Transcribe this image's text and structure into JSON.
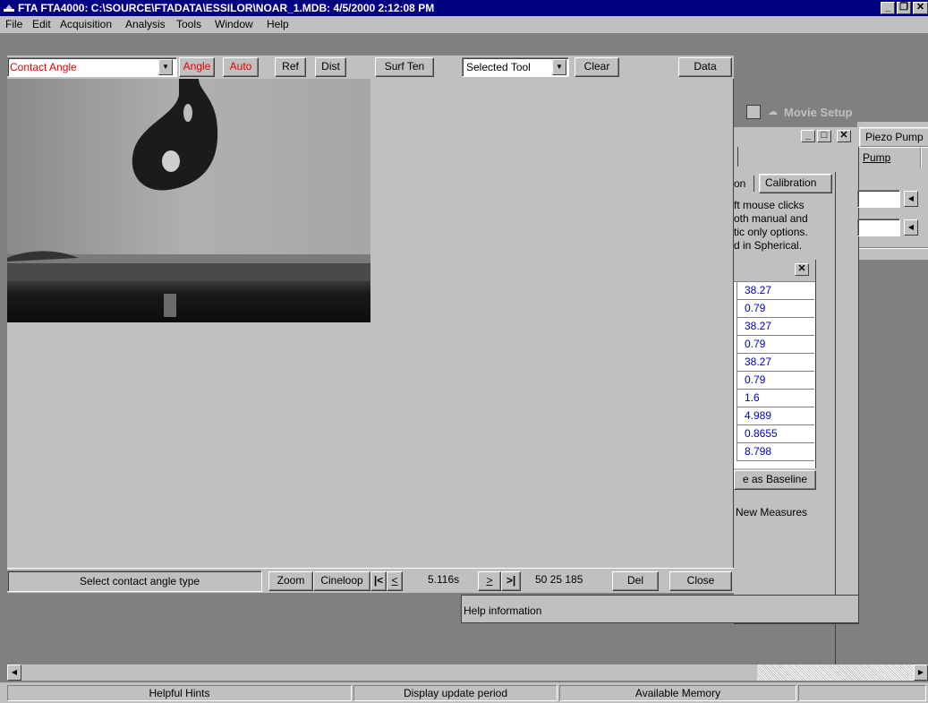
{
  "window": {
    "title": "FTA FTA4000: C:\\SOURCE\\FTADATA\\ESSILOR\\NOAR_1.MDB: 4/5/2000 2:12:08 PM",
    "minimize": "_",
    "restore": "❐",
    "close": "✕"
  },
  "menu": {
    "file": "File",
    "edit": "Edit",
    "acquisition": "Acquisition",
    "analysis": "Analysis",
    "tools": "Tools",
    "window": "Window",
    "help": "Help"
  },
  "toolbar": {
    "measurement_type": "Contact Angle",
    "angle": "Angle",
    "auto": "Auto",
    "ref": "Ref",
    "dist": "Dist",
    "surf_ten": "Surf Ten",
    "tool_select": "Selected Tool",
    "clear": "Clear",
    "data": "Data"
  },
  "movie_setup": {
    "title": "Movie Setup",
    "tab_piezo": "Piezo Pump",
    "pump": "Pump"
  },
  "analysis_panel": {
    "tab_partial": "on",
    "tab_calibration": "Calibration",
    "hint_line1": "ft mouse clicks",
    "hint_line2": "oth manual and",
    "hint_line3": "tic only options.",
    "hint_line4": "d in Spherical.",
    "close": "✕",
    "values": [
      "38.27",
      "0.79",
      "38.27",
      "0.79",
      "38.27",
      "0.79",
      "1.6",
      "4.989",
      "0.8655",
      "8.798"
    ],
    "baseline_button": "e as Baseline",
    "new_measures": "New Measures"
  },
  "bottom_bar": {
    "hint": "Select contact angle type",
    "zoom": "Zoom",
    "cineloop": "Cineloop",
    "first": "|<",
    "prev": "<",
    "time": "5.116s",
    "next": ">",
    "last": ">|",
    "frame_info": "50  25  185",
    "del": "Del",
    "close": "Close"
  },
  "help_info": "Help information",
  "status": {
    "hints": "Helpful Hints",
    "update": "Display update period",
    "memory": "Available Memory"
  },
  "colors": {
    "titlebar": "#000080",
    "face": "#c0c0c0",
    "accent_red": "#e00000",
    "value_blue": "#0000c0"
  }
}
